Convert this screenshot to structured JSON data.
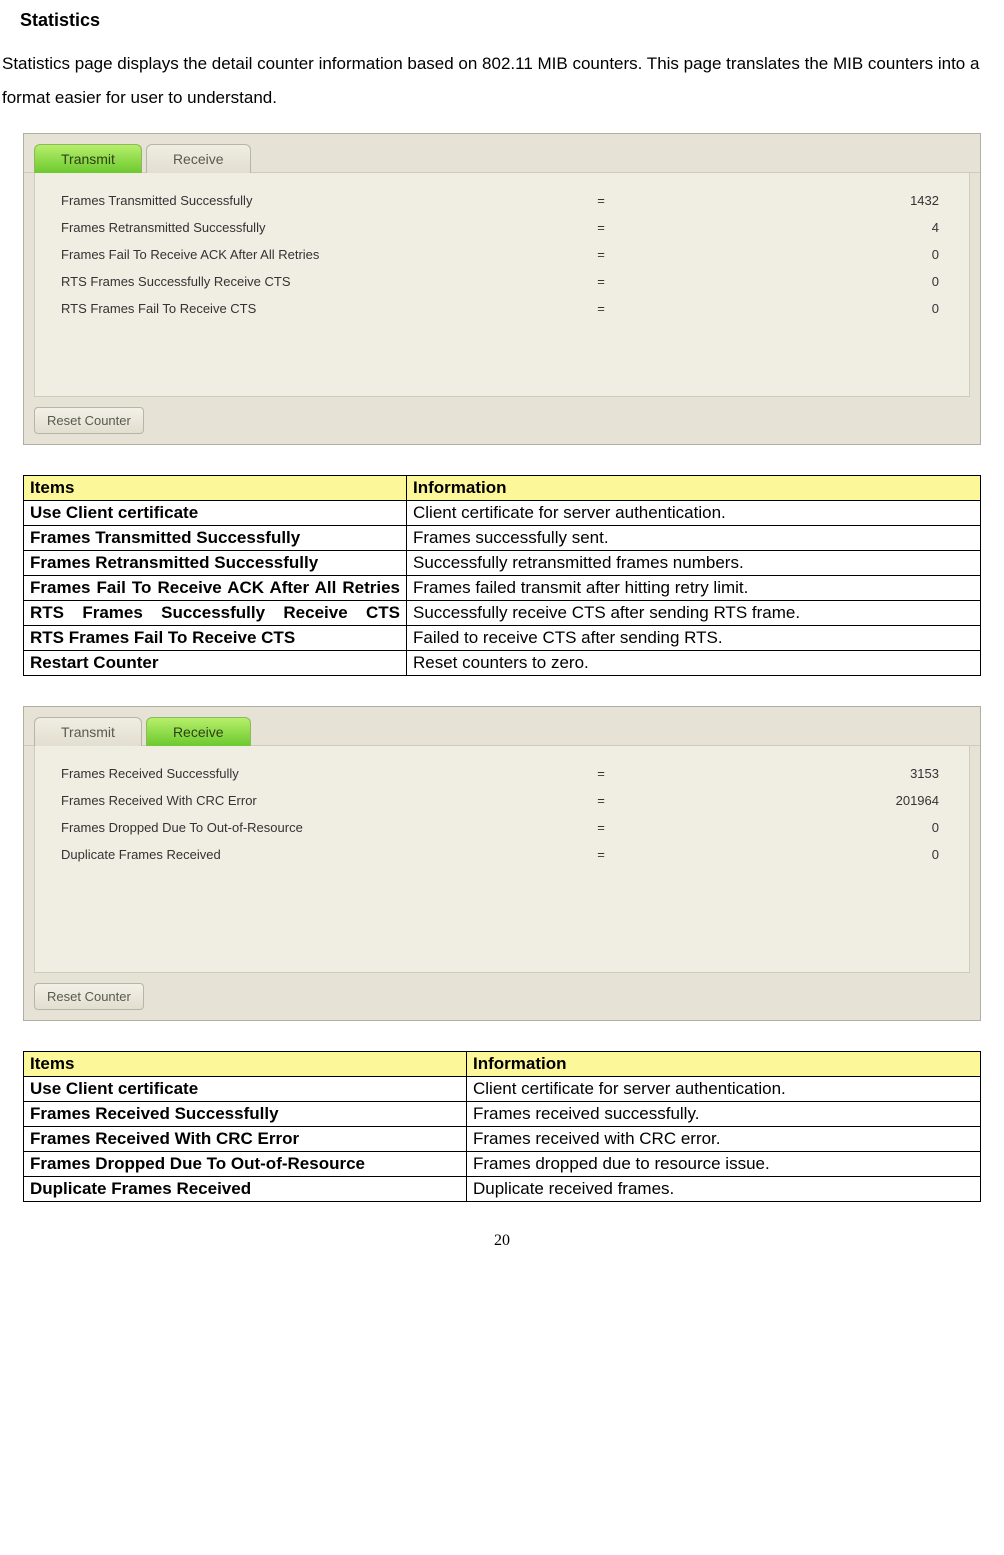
{
  "section_title": "Statistics",
  "intro": "Statistics page displays the detail counter information based on 802.11 MIB counters. This page translates the MIB counters into a format easier for user to understand.",
  "transmit_panel": {
    "tab_transmit": "Transmit",
    "tab_receive": "Receive",
    "rows": {
      "r0": {
        "label": "Frames Transmitted Successfully",
        "eq": "=",
        "val": "1432"
      },
      "r1": {
        "label": "Frames Retransmitted Successfully",
        "eq": "=",
        "val": "4"
      },
      "r2": {
        "label": "Frames Fail To Receive ACK After All Retries",
        "eq": "=",
        "val": "0"
      },
      "r3": {
        "label": "RTS Frames Successfully Receive CTS",
        "eq": "=",
        "val": "0"
      },
      "r4": {
        "label": "RTS Frames Fail To Receive CTS",
        "eq": "=",
        "val": "0"
      }
    },
    "reset": "Reset Counter"
  },
  "table1": {
    "h_items": "Items",
    "h_info": "Information",
    "r0": {
      "item": "Use Client certificate",
      "info": "Client certificate for server authentication."
    },
    "r1": {
      "item": "Frames Transmitted Successfully",
      "info": "Frames successfully sent."
    },
    "r2": {
      "item": "Frames Retransmitted Successfully",
      "info": "Successfully retransmitted frames numbers."
    },
    "r3": {
      "item": "Frames Fail To Receive ACK After All Retries",
      "info": "Frames failed transmit after hitting retry limit."
    },
    "r4": {
      "item": "RTS Frames Successfully Receive CTS",
      "info": "Successfully receive CTS after sending RTS frame."
    },
    "r5": {
      "item": "RTS Frames Fail To Receive CTS",
      "info": "Failed to receive CTS after sending RTS."
    },
    "r6": {
      "item": "Restart Counter",
      "info": "Reset counters to zero."
    }
  },
  "receive_panel": {
    "tab_transmit": "Transmit",
    "tab_receive": "Receive",
    "rows": {
      "r0": {
        "label": "Frames Received Successfully",
        "eq": "=",
        "val": "3153"
      },
      "r1": {
        "label": "Frames Received With CRC Error",
        "eq": "=",
        "val": "201964"
      },
      "r2": {
        "label": "Frames Dropped Due To Out-of-Resource",
        "eq": "=",
        "val": "0"
      },
      "r3": {
        "label": "Duplicate Frames Received",
        "eq": "=",
        "val": "0"
      }
    },
    "reset": "Reset Counter"
  },
  "table2": {
    "h_items": "Items",
    "h_info": "Information",
    "r0": {
      "item": "Use Client certificate",
      "info": "Client certificate for server authentication."
    },
    "r1": {
      "item": "Frames Received Successfully",
      "info": "Frames received successfully."
    },
    "r2": {
      "item": "Frames Received With CRC Error",
      "info": "Frames received with CRC error."
    },
    "r3": {
      "item": "Frames Dropped Due To Out-of-Resource",
      "info": "Frames dropped due to resource issue."
    },
    "r4": {
      "item": "Duplicate Frames Received",
      "info": "Duplicate received frames."
    }
  },
  "page_number": "20"
}
